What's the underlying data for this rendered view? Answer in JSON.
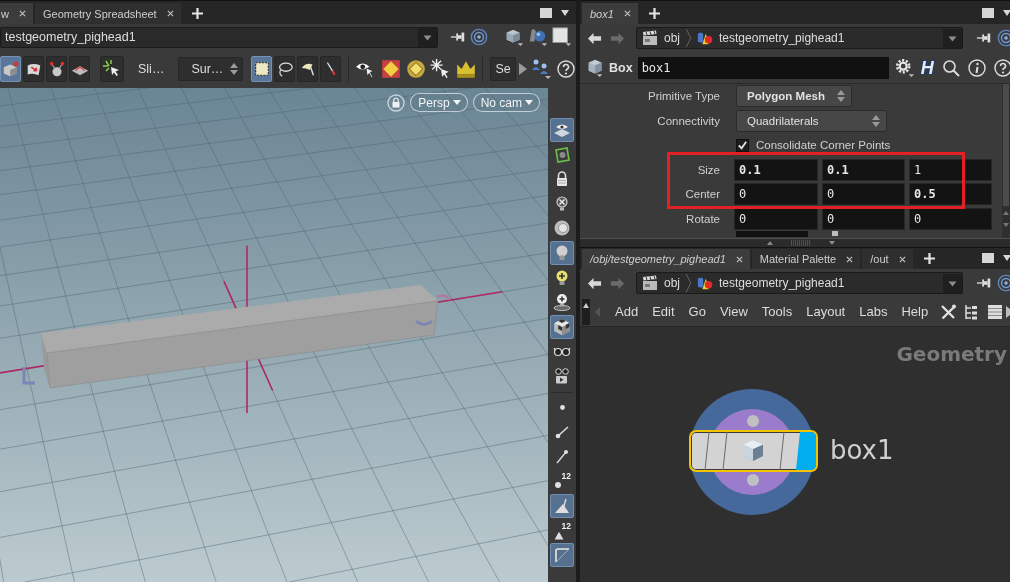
{
  "left_pane": {
    "tabs": [
      {
        "label": "w",
        "selected": true,
        "follows_selection": false
      },
      {
        "label": "Geometry Spreadsheet",
        "selected": false,
        "follows_selection": false
      }
    ],
    "path": "testgeometry_pighead1",
    "toolbar": {
      "modes": [
        {
          "kind": "object",
          "selected": true
        },
        {
          "kind": "geometry",
          "selected": false
        },
        {
          "kind": "pose",
          "selected": false
        },
        {
          "kind": "dynamics",
          "selected": false
        }
      ],
      "snap_label": "Sli…",
      "selection_menu": "Sur…",
      "select_tools": [
        {
          "kind": "box",
          "selected": true
        },
        {
          "kind": "lasso",
          "selected": false
        },
        {
          "kind": "brush",
          "selected": false
        },
        {
          "kind": "laser",
          "selected": false
        }
      ],
      "cut_button": "Se"
    },
    "viewport": {
      "view_menus": [
        "Persp",
        "No cam"
      ]
    },
    "display_toolbar": {
      "scene": [
        {
          "kind": "ghost",
          "on": true
        },
        {
          "kind": "template",
          "on": false
        },
        {
          "kind": "lock",
          "on": false
        },
        {
          "kind": "lightoff",
          "on": false
        },
        {
          "kind": "disc",
          "on": false
        },
        {
          "kind": "headlight",
          "on": true
        },
        {
          "kind": "lightadd",
          "on": false
        },
        {
          "kind": "lightbase",
          "on": false
        },
        {
          "kind": "shading",
          "on": true
        },
        {
          "kind": "stereo",
          "on": false
        },
        {
          "kind": "camera",
          "on": false
        }
      ],
      "guides": [
        {
          "kind": "points",
          "on": false
        },
        {
          "kind": "normals",
          "on": false
        },
        {
          "kind": "pointnormals",
          "on": false
        },
        {
          "kind": "pointnumbers",
          "on": false,
          "badge": "12"
        },
        {
          "kind": "primnormals",
          "on": true
        },
        {
          "kind": "primnumbers",
          "on": false,
          "badge": "12"
        },
        {
          "kind": "backfaces",
          "on": true
        }
      ]
    }
  },
  "right_pane": {
    "tabs": [
      {
        "label": "box1",
        "selected": true,
        "follows_selection": true
      }
    ],
    "path": [
      "obj",
      "testgeometry_pighead1"
    ],
    "node_type": "Box",
    "node_name": "box1",
    "help_badge": "H",
    "parameters": [
      {
        "kind": "menu",
        "label": "Primitive Type",
        "value": "Polygon Mesh",
        "non_default": true
      },
      {
        "kind": "menu",
        "label": "Connectivity",
        "value": "Quadrilaterals",
        "non_default": false
      },
      {
        "kind": "toggle",
        "label": "Consolidate Corner Points",
        "checked": true
      },
      {
        "kind": "vector",
        "label": "Size",
        "values": [
          {
            "text": "0.1",
            "non_default": true
          },
          {
            "text": "0.1",
            "non_default": true
          },
          {
            "text": "1",
            "non_default": false
          }
        ]
      },
      {
        "kind": "vector",
        "label": "Center",
        "values": [
          {
            "text": "0",
            "non_default": false
          },
          {
            "text": "0",
            "non_default": false
          },
          {
            "text": "0.5",
            "non_default": true
          }
        ]
      },
      {
        "kind": "vector",
        "label": "Rotate",
        "values": [
          {
            "text": "0",
            "non_default": false
          },
          {
            "text": "0",
            "non_default": false
          },
          {
            "text": "0",
            "non_default": false
          }
        ]
      }
    ]
  },
  "network_pane": {
    "tabs": [
      {
        "label": "/obj/testgeometry_pighead1",
        "selected": true,
        "follows_selection": true
      },
      {
        "label": "Material Palette",
        "selected": false,
        "follows_selection": false
      },
      {
        "label": "/out",
        "selected": false,
        "follows_selection": false
      }
    ],
    "path": [
      "obj",
      "testgeometry_pighead1"
    ],
    "menu": [
      "Add",
      "Edit",
      "Go",
      "View",
      "Tools",
      "Layout",
      "Labs",
      "Help"
    ],
    "network_label": "Geometry",
    "node": {
      "name": "box1",
      "selected": true,
      "display_flag": true
    }
  }
}
